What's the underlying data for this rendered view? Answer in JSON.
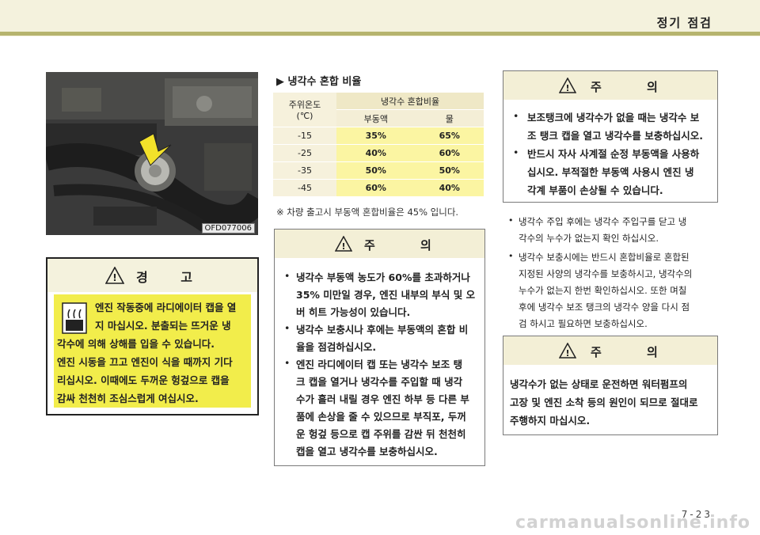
{
  "header": {
    "section_title": "정기 점검"
  },
  "photo": {
    "code": "OFD077006"
  },
  "warning": {
    "title": "경 고",
    "lines": [
      "엔진 작동중에 라디에이터 캡을 열",
      "지 마십시오. 분출되는 뜨거운 냉",
      "각수에 의해 상해를 입을 수 있습니다.",
      "엔진 시동을 끄고 엔진이 식을 때까지 기다",
      "리십시오. 이때에도 두꺼운 헝겊으로 캡을",
      "감싸 천천히 조심스럽게 여십시오."
    ]
  },
  "mix": {
    "title": "▶ 냉각수 혼합 비율",
    "col_temp": "주위온도",
    "col_temp_unit": "(℃)",
    "col_ratio": "냉각수 혼합비율",
    "col_antifreeze": "부동액",
    "col_water": "물",
    "rows": [
      {
        "temp": "-15",
        "antifreeze": "35%",
        "water": "65%"
      },
      {
        "temp": "-25",
        "antifreeze": "40%",
        "water": "60%"
      },
      {
        "temp": "-35",
        "antifreeze": "50%",
        "water": "50%"
      },
      {
        "temp": "-45",
        "antifreeze": "60%",
        "water": "40%"
      }
    ],
    "note": "※ 차량 출고시 부동액 혼합비율은 45% 입니다."
  },
  "caution_middle": {
    "title": "주 의",
    "lines": [
      "냉각수 부동액 농도가 60%를 초과하거나",
      "35% 미만일 경우, 엔진 내부의 부식 및 오",
      "버 히트 가능성이 있습니다.",
      "냉각수 보충시나 후에는 부동액의 혼합 비",
      "율을 점검하십시오.",
      "엔진 라디에이터 캡 또는 냉각수 보조 탱",
      "크 캡을 열거나 냉각수를 주입할 때 냉각",
      "수가 흘러 내릴 경우 엔진 하부 등 다른 부",
      "품에 손상을 줄 수 있으므로 부직포, 두꺼",
      "운 헝겊 등으로 캡 주위를 감싼 뒤 천천히",
      "캡을 열고 냉각수를 보충하십시오."
    ]
  },
  "caution_top_right": {
    "title": "주 의",
    "lines": [
      "보조탱크에 냉각수가 없을 때는 냉각수 보",
      "조 탱크 캡을 열고 냉각수를 보충하십시오.",
      "반드시 자사 사계절 순정 부동액을 사용하",
      "십시오. 부적절한 부동액 사용시 엔진 냉",
      "각계 부품이 손상될 수 있습니다."
    ]
  },
  "right_list": [
    "냉각수 주입 후에는 냉각수 주입구를 닫고 냉",
    "각수의 누수가 없는지 확인 하십시오.",
    "냉각수 보충시에는 반드시 혼합비율로 혼합된",
    "지정된 사양의 냉각수를 보충하시고, 냉각수의",
    "누수가 없는지 한번 확인하십시오. 또한 며칠",
    "후에 냉각수 보조 탱크의 냉각수 양을 다시 점",
    "검 하시고 필요하면 보충하십시오."
  ],
  "caution_bottom_right": {
    "title": "주 의",
    "lines": [
      "냉각수가 없는 상태로 운전하면 워터펌프의",
      "고장 및 엔진 소착 등의 원인이 되므로 절대로",
      "주행하지 마십시오."
    ]
  },
  "bullet_char": "•",
  "warn_symbol": "!",
  "page_number": "7-23",
  "watermark": "carmanualsonline.info"
}
